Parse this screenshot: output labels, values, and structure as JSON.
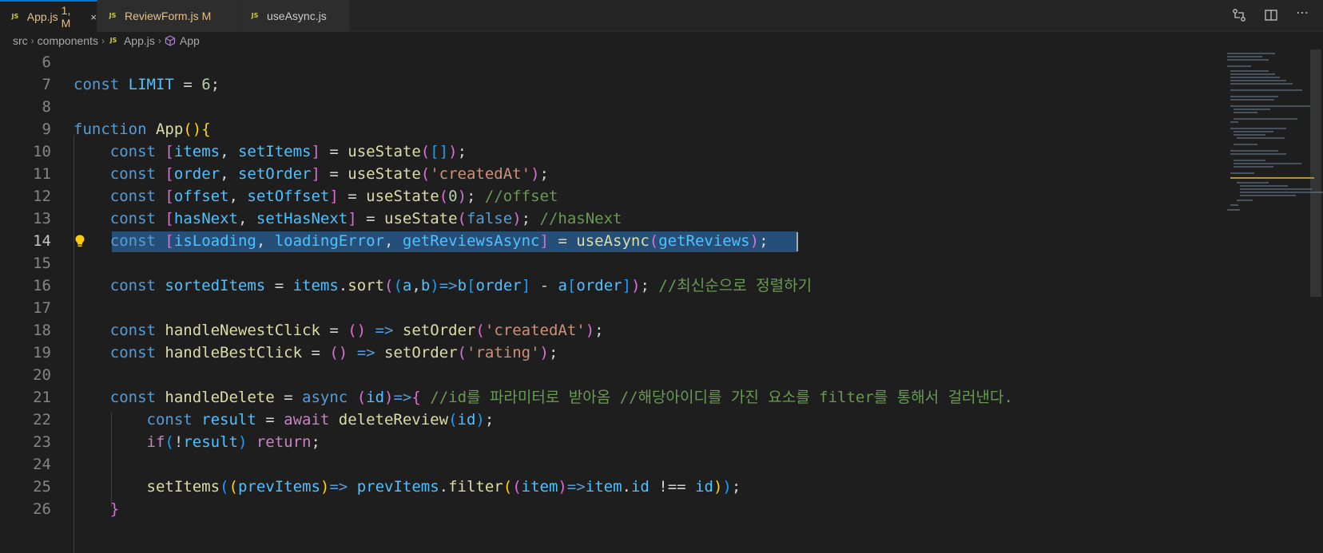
{
  "tabs": [
    {
      "label": "App.js",
      "status": "1, M",
      "icon": "js-file-icon",
      "active": true,
      "color": "#e2c08d"
    },
    {
      "label": "ReviewForm.js",
      "status": "M",
      "icon": "js-file-icon",
      "active": false,
      "color": "#e2c08d"
    },
    {
      "label": "useAsync.js",
      "status": "",
      "icon": "js-file-icon",
      "active": false,
      "color": "#cccccc"
    }
  ],
  "tab_close_glyph": "×",
  "breadcrumb": {
    "items": [
      "src",
      "components",
      "App.js",
      "App"
    ],
    "separator": "›"
  },
  "editor": {
    "current_line": 14,
    "lines": [
      {
        "num": "6",
        "text": ""
      },
      {
        "num": "7",
        "text": "const LIMIT = 6;"
      },
      {
        "num": "8",
        "text": ""
      },
      {
        "num": "9",
        "text": "function App(){"
      },
      {
        "num": "10",
        "text": "    const [items, setItems] = useState([]);"
      },
      {
        "num": "11",
        "text": "    const [order, setOrder] = useState('createdAt');"
      },
      {
        "num": "12",
        "text": "    const [offset, setOffset] = useState(0); //offset"
      },
      {
        "num": "13",
        "text": "    const [hasNext, setHasNext] = useState(false); //hasNext"
      },
      {
        "num": "14",
        "text": "    const [isLoading, loadingError, getReviewsAsync] = useAsync(getReviews);"
      },
      {
        "num": "15",
        "text": ""
      },
      {
        "num": "16",
        "text": "    const sortedItems = items.sort((a,b)=>b[order] - a[order]); //최신순으로 정렬하기"
      },
      {
        "num": "17",
        "text": ""
      },
      {
        "num": "18",
        "text": "    const handleNewestClick = () => setOrder('createdAt');"
      },
      {
        "num": "19",
        "text": "    const handleBestClick = () => setOrder('rating');"
      },
      {
        "num": "20",
        "text": ""
      },
      {
        "num": "21",
        "text": "    const handleDelete = async (id)=>{ //id를 파라미터로 받아옴 //해당아이디를 가진 요소를 filter를 통해서 걸러낸다."
      },
      {
        "num": "22",
        "text": "        const result = await deleteReview(id);"
      },
      {
        "num": "23",
        "text": "        if(!result) return;"
      },
      {
        "num": "24",
        "text": ""
      },
      {
        "num": "25",
        "text": "        setItems((prevItems)=> prevItems.filter((item)=>item.id !== id));"
      },
      {
        "num": "26",
        "text": "    }"
      }
    ]
  },
  "colors": {
    "background": "#1e1e1e",
    "keyword": "#569cd6",
    "variable": "#9cdcfe",
    "constant": "#4fc1ff",
    "function": "#dcdcaa",
    "string": "#ce9178",
    "number": "#b5cea8",
    "comment": "#6a9955",
    "control": "#c586c0",
    "selection": "#264f78",
    "modified_tab": "#e2c08d"
  },
  "icons": {
    "lightbulb": "lightbulb-icon",
    "symbol": "symbol-class-icon",
    "compare": "compare-changes-icon",
    "split": "split-editor-icon"
  }
}
